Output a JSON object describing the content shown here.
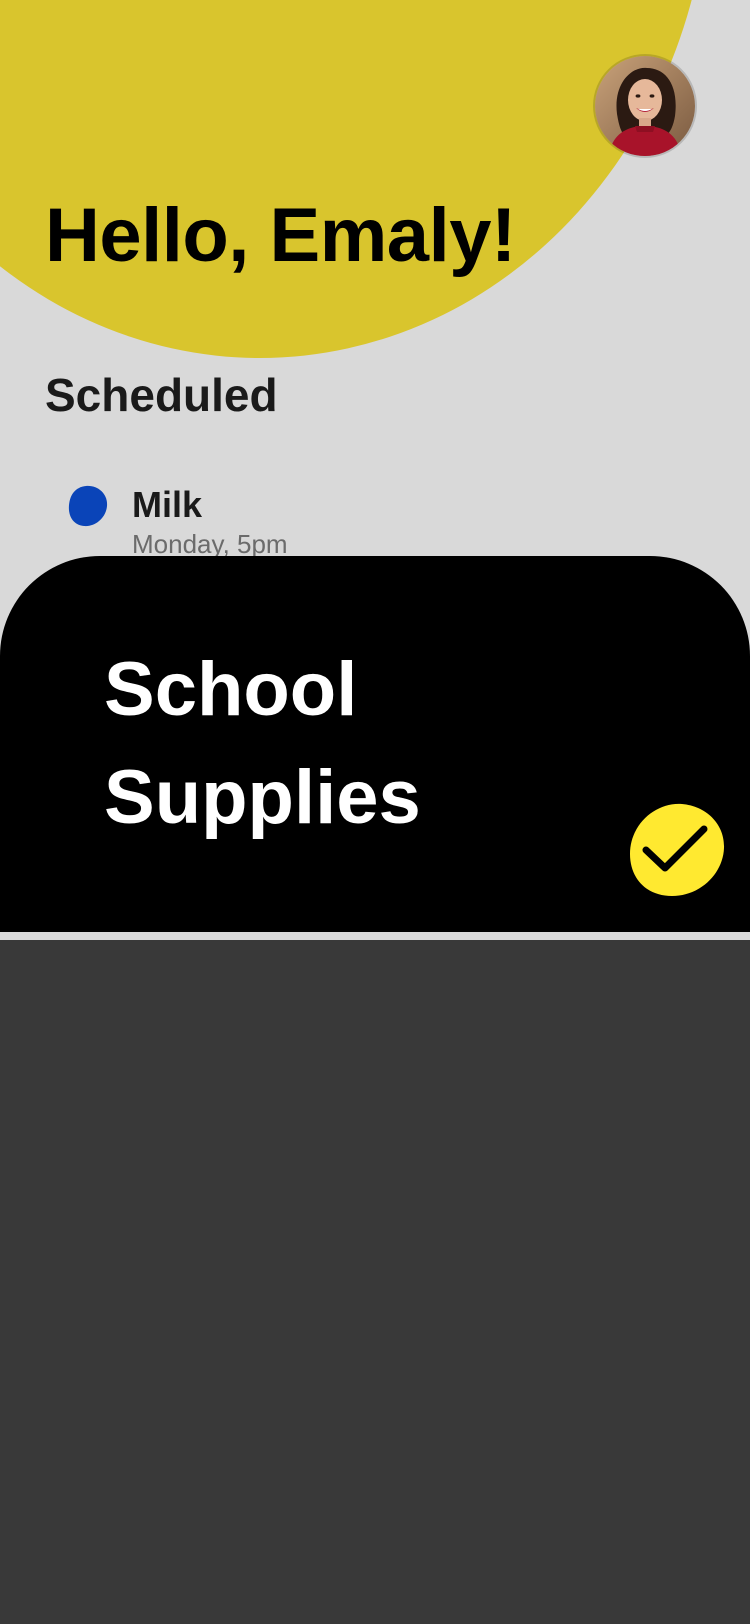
{
  "header": {
    "greeting": "Hello, Emaly!",
    "avatar_icon": "user-avatar-photo"
  },
  "scheduled": {
    "title": "Scheduled",
    "items": [
      {
        "name": "Milk",
        "time": "Monday, 5pm",
        "dot_color": "#0a44b8",
        "icon": "blob-dot-icon"
      }
    ]
  },
  "card": {
    "title": "School Supplies",
    "check_icon": "checkmark-icon",
    "check_color": "#ffe930"
  },
  "colors": {
    "accent_yellow": "#d9c52d",
    "background_light": "#d9d9d9",
    "background_dark": "#393939",
    "card": "#000000"
  }
}
